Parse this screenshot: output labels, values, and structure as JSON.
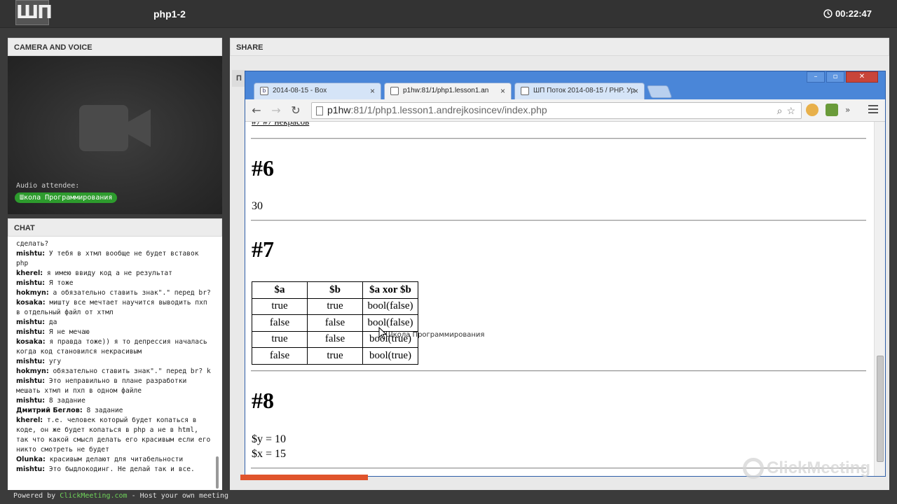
{
  "header": {
    "logo_text": "ШП",
    "meeting_title": "php1-2",
    "timer": "00:22:47"
  },
  "camera": {
    "title": "CAMERA AND VOICE",
    "audio_label": "Audio attendee:",
    "audio_attendee": "Школа Программирования"
  },
  "chat": {
    "title": "CHAT",
    "messages": [
      {
        "who": "",
        "text": "сделать?"
      },
      {
        "who": "mishtu:",
        "text": "У тебя в хтмл вообще не будет вставок php"
      },
      {
        "who": "kherel:",
        "text": "я имею ввиду код а не результат"
      },
      {
        "who": "mishtu:",
        "text": "Я тоже"
      },
      {
        "who": "hokmyn:",
        "text": "а обязательно ставить знак\".\" перед br?"
      },
      {
        "who": "kosaka:",
        "text": "миштy все мечтает научится выводить пхп в отдельный файл от хтмл"
      },
      {
        "who": "mishtu:",
        "text": "да"
      },
      {
        "who": "mishtu:",
        "text": "Я не мечаю"
      },
      {
        "who": "kosaka:",
        "text": "я правда тоже)) я то депрессия началась когда код становился некрасивым"
      },
      {
        "who": "mishtu:",
        "text": "угу"
      },
      {
        "who": "hokmyn:",
        "text": "обязательно ставить знак\".\" перед br? k"
      },
      {
        "who": "mishtu:",
        "text": "Это неправильно в плане разработки мешать хтмл и пхп в одном файле"
      },
      {
        "who": "mishtu:",
        "text": "8 задание"
      },
      {
        "who": "Дмитрий Беглов:",
        "text": "8 задание"
      },
      {
        "who": "kherel:",
        "text": "т.е. человек который будет копаться в коде, он же будет копаться в php а не в html, так что какой смысл делать его красивым если его никто смотреть не будет"
      },
      {
        "who": "Olunka:",
        "text": "красивым делают для читабельности"
      },
      {
        "who": "mishtu:",
        "text": "Это быдлокодинг. Не делай так и все."
      }
    ]
  },
  "footer": {
    "prefix": "Powered by",
    "link": "ClickMeeting.com",
    "suffix": "- Host your own meeting"
  },
  "share": {
    "title": "SHARE",
    "left_tab": "П"
  },
  "browser": {
    "tabs": [
      {
        "label": "2014-08-15 - Box",
        "favicon": "b"
      },
      {
        "label": "p1hw:81/1/php1.lesson1.an",
        "favicon": ""
      },
      {
        "label": "ШП Поток 2014-08-15 / PHP. Ур",
        "favicon": ""
      }
    ],
    "url_host": "p1hw",
    "url_rest": ":81/1/php1.lesson1.andrejkosincev/index.php",
    "page": {
      "cut_link": "#7 #7 некрасов",
      "sections": [
        {
          "heading": "#6",
          "text": "30"
        },
        {
          "heading": "#7"
        },
        {
          "heading": "#8",
          "lines": [
            "$y = 10",
            "$x = 15"
          ]
        }
      ],
      "table": {
        "headers": [
          "$a",
          "$b",
          "$a xor $b"
        ],
        "rows": [
          [
            "true",
            "true",
            "bool(false)"
          ],
          [
            "false",
            "false",
            "bool(false)"
          ],
          [
            "true",
            "false",
            "bool(true)"
          ],
          [
            "false",
            "true",
            "bool(true)"
          ]
        ]
      },
      "cursor_label": "Школа Программирования"
    }
  },
  "watermark": "ClickMeeting",
  "colors": {
    "accent_green": "#2d9b2d",
    "browser_frame": "#4a86d8",
    "footer_link": "#6fd35a"
  }
}
